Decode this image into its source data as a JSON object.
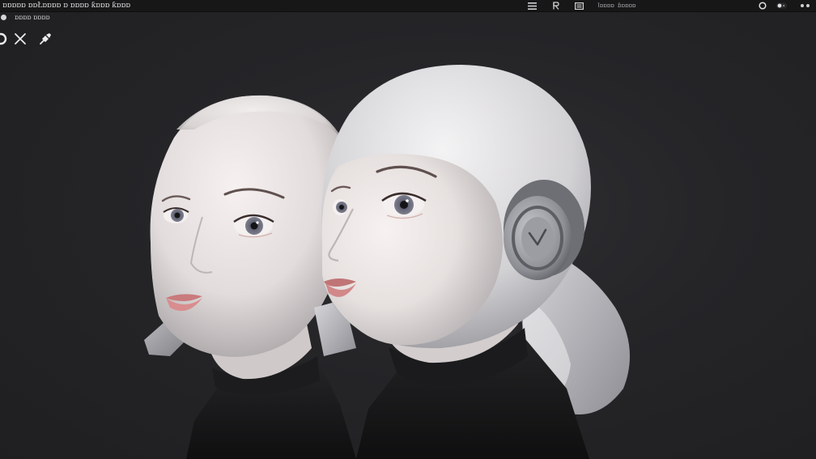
{
  "window": {
    "title": "ɒɒɒɒɒ ɒɒŁɒɒɒɒ ɒ ɒɒɒɒ ƙɒɒɒ ƙɒɒɒ"
  },
  "topbar": {
    "right_label_1": "Ɩɒɒɒɒ",
    "right_label_2": "ɓɒɒɒɒ",
    "icons": [
      "menu-icon",
      "person-icon",
      "panel-icon",
      "circle-icon",
      "toggle-icon"
    ]
  },
  "subbar": {
    "label": "ɒɒɒɒ ɒɒɒɒ"
  },
  "tools": [
    "partial-icon",
    "close-icon",
    "pin-icon"
  ],
  "colors": {
    "background": "#232325",
    "topbar": "#171718",
    "skin": "#e8e3e2",
    "sweater": "#141416",
    "headphone": "#8e8f95"
  }
}
